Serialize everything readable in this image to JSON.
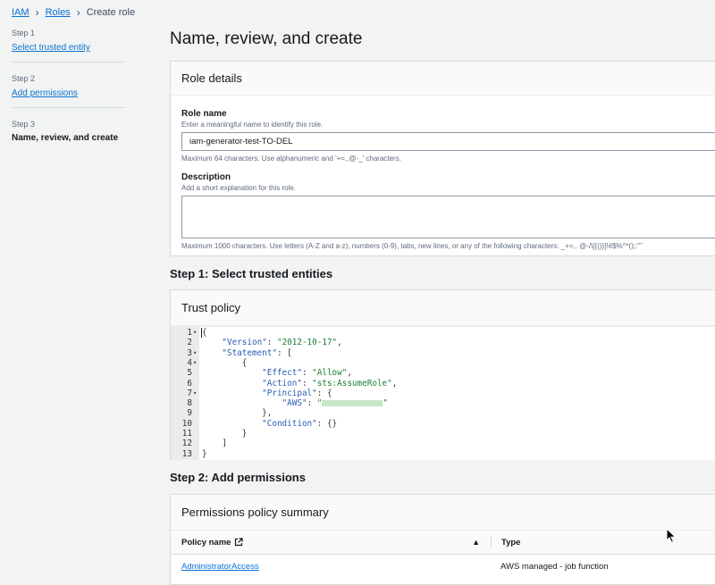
{
  "breadcrumb": {
    "items": [
      {
        "label": "IAM",
        "link": true
      },
      {
        "label": "Roles",
        "link": true
      },
      {
        "label": "Create role",
        "link": false
      }
    ]
  },
  "steps": [
    {
      "num": "Step 1",
      "label": "Select trusted entity",
      "state": "link"
    },
    {
      "num": "Step 2",
      "label": "Add permissions",
      "state": "link"
    },
    {
      "num": "Step 3",
      "label": "Name, review, and create",
      "state": "current"
    }
  ],
  "page_title": "Name, review, and create",
  "role_details": {
    "header": "Role details",
    "role_name_label": "Role name",
    "role_name_desc": "Enter a meaningful name to identify this role.",
    "role_name_value": "iam-generator-test-TO-DEL",
    "role_name_hint": "Maximum 64 characters. Use alphanumeric and '+=,.@-_' characters.",
    "description_label": "Description",
    "description_desc": "Add a short explanation for this role.",
    "description_value": "",
    "description_hint": "Maximum 1000 characters. Use letters (A-Z and a-z), numbers (0-9), tabs, new lines, or any of the following characters: _+=,. @-/\\[{()}]!#$%^*();:\"'`"
  },
  "step1": {
    "title": "Step 1: Select trusted entities",
    "panel_header": "Trust policy",
    "code_lines": [
      {
        "n": "1",
        "fold": true,
        "text": "{"
      },
      {
        "n": "2",
        "fold": false,
        "text": "    \"Version\": \"2012-10-17\","
      },
      {
        "n": "3",
        "fold": true,
        "text": "    \"Statement\": ["
      },
      {
        "n": "4",
        "fold": true,
        "text": "        {"
      },
      {
        "n": "5",
        "fold": false,
        "text": "            \"Effect\": \"Allow\","
      },
      {
        "n": "6",
        "fold": false,
        "text": "            \"Action\": \"sts:AssumeRole\","
      },
      {
        "n": "7",
        "fold": true,
        "text": "            \"Principal\": {"
      },
      {
        "n": "8",
        "fold": false,
        "text": "                \"AWS\": \"[masked]\""
      },
      {
        "n": "9",
        "fold": false,
        "text": "            },"
      },
      {
        "n": "10",
        "fold": false,
        "text": "            \"Condition\": {}"
      },
      {
        "n": "11",
        "fold": false,
        "text": "        }"
      },
      {
        "n": "12",
        "fold": false,
        "text": "    ]"
      },
      {
        "n": "13",
        "fold": false,
        "text": "}"
      }
    ]
  },
  "step2": {
    "title": "Step 2: Add permissions",
    "panel_header": "Permissions policy summary",
    "col_policy_name": "Policy name",
    "col_type": "Type",
    "rows": [
      {
        "name": "AdministratorAccess",
        "type": "AWS managed - job function"
      }
    ]
  },
  "icons": {
    "fold": "▾",
    "sort": "▲",
    "external": "external-link-icon",
    "separator": "chevron-right-icon"
  }
}
